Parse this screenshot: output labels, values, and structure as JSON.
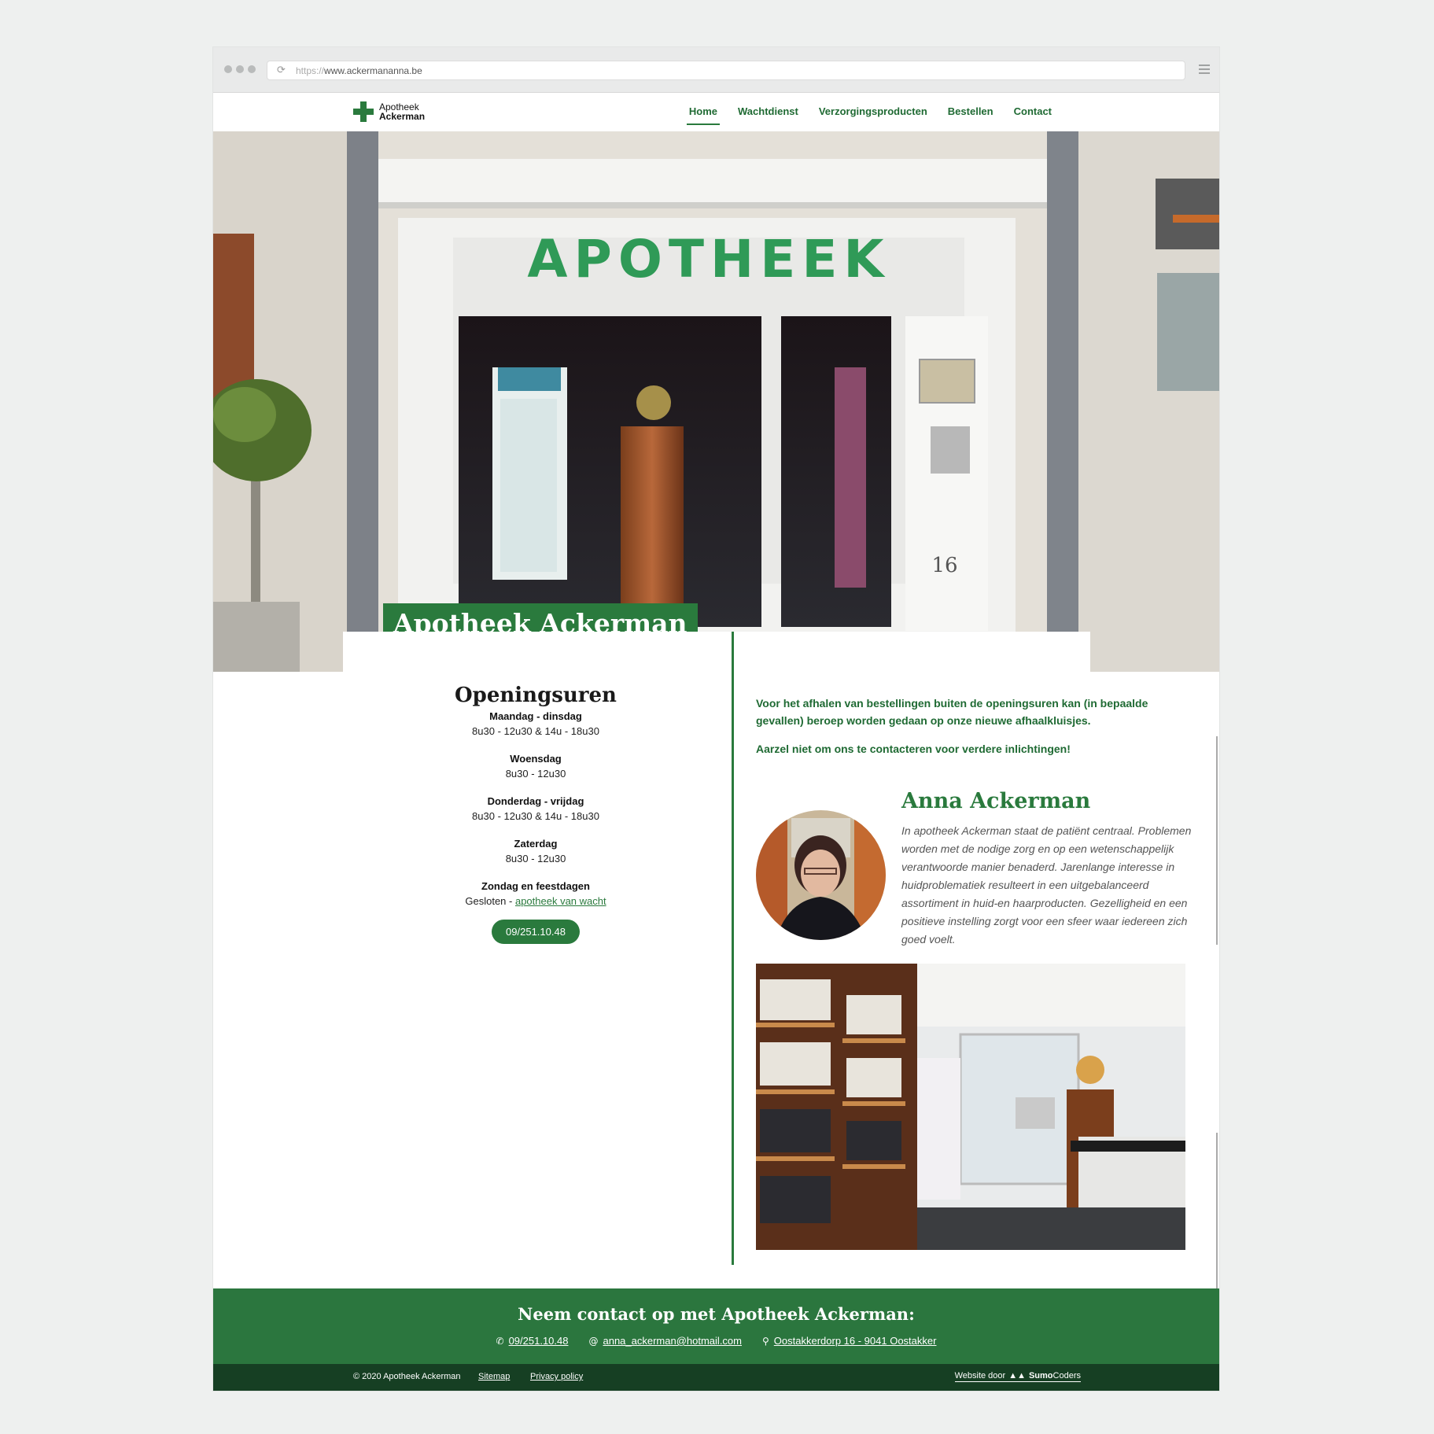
{
  "browser": {
    "url_protocol": "https://",
    "url_host": "www.ackermananna.be"
  },
  "header": {
    "logo_line1": "Apotheek",
    "logo_line2": "Ackerman",
    "nav": [
      "Home",
      "Wachtdienst",
      "Verzorgingsproducten",
      "Bestellen",
      "Contact"
    ],
    "active_nav": "Home"
  },
  "hero": {
    "sign_text": "APOTHEEK",
    "house_number": "16",
    "title": "Apotheek Ackerman"
  },
  "hours": {
    "heading": "Openingsuren",
    "days": [
      {
        "day": "Maandag - dinsdag",
        "time": "8u30 - 12u30 & 14u - 18u30"
      },
      {
        "day": "Woensdag",
        "time": "8u30 - 12u30"
      },
      {
        "day": "Donderdag - vrijdag",
        "time": "8u30 - 12u30 & 14u - 18u30"
      },
      {
        "day": "Zaterdag",
        "time": "8u30 - 12u30"
      }
    ],
    "closed_day": "Zondag en feestdagen",
    "closed_text": "Gesloten - ",
    "closed_link": "apotheek van wacht",
    "phone_button": "09/251.10.48"
  },
  "intro": {
    "p1": "Voor het afhalen van bestellingen buiten de openingsuren kan (in bepaalde gevallen) beroep worden gedaan op onze nieuwe afhaalkluisjes.",
    "p2": "Aarzel niet om ons te contacteren voor verdere inlichtingen!"
  },
  "profile": {
    "name": "Anna Ackerman",
    "bio": "In apotheek Ackerman staat de patiënt centraal. Problemen worden met de nodige zorg en op een wetenschappelijk verantwoorde manier benaderd. Jarenlange interesse in huidproblematiek resulteert in een uitgebalanceerd assortiment in huid-en haarproducten. Gezelligheid en een positieve instelling zorgt voor een sfeer waar iedereen zich goed voelt."
  },
  "contact": {
    "heading": "Neem contact op met Apotheek Ackerman:",
    "phone": "09/251.10.48",
    "email": "anna_ackerman@hotmail.com",
    "address": "Oostakkerdorp 16 - 9041 Oostakker"
  },
  "footer": {
    "copyright": "© 2020 Apotheek Ackerman",
    "sitemap": "Sitemap",
    "privacy": "Privacy policy",
    "credit_prefix": "Website door",
    "credit_brand_bold": "Sumo",
    "credit_brand_rest": "Coders"
  },
  "colors": {
    "brand_green": "#2a7a3d",
    "footer_dark": "#163f23"
  }
}
